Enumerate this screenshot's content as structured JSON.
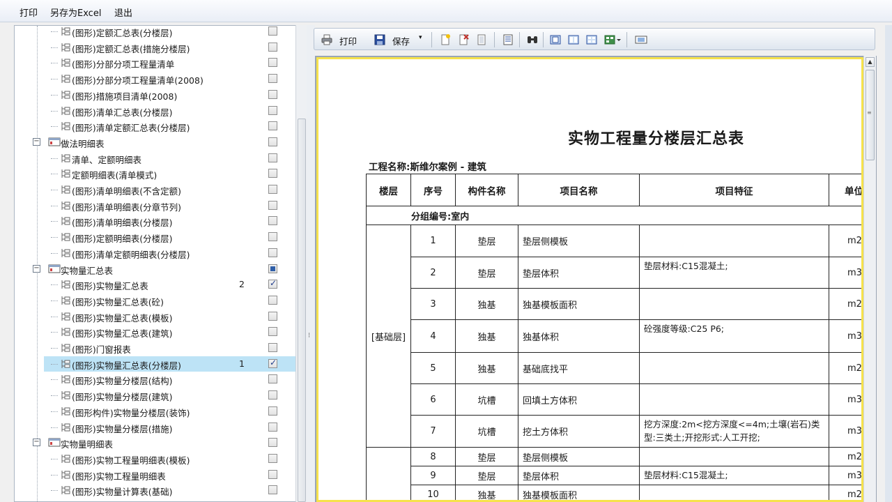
{
  "menu": {
    "print": "打印",
    "save_excel": "另存为Excel",
    "exit": "退出"
  },
  "tree": {
    "rows": [
      {
        "label": "(图形)定额汇总表(分楼层)",
        "checked": false,
        "count": ""
      },
      {
        "label": "(图形)定额汇总表(措施分楼层)",
        "checked": false,
        "count": ""
      },
      {
        "label": "(图形)分部分项工程量清单",
        "checked": false,
        "count": ""
      },
      {
        "label": "(图形)分部分项工程量清单(2008)",
        "checked": false,
        "count": ""
      },
      {
        "label": "(图形)措施项目清单(2008)",
        "checked": false,
        "count": ""
      },
      {
        "label": "(图形)清单汇总表(分楼层)",
        "checked": false,
        "count": ""
      },
      {
        "label": "(图形)清单定额汇总表(分楼层)",
        "checked": false,
        "count": ""
      },
      {
        "label": "做法明细表",
        "group": true,
        "checked": false,
        "count": ""
      },
      {
        "label": "清单、定额明细表",
        "checked": false,
        "count": ""
      },
      {
        "label": "定额明细表(清单模式)",
        "checked": false,
        "count": ""
      },
      {
        "label": "(图形)清单明细表(不含定额)",
        "checked": false,
        "count": ""
      },
      {
        "label": "(图形)清单明细表(分章节列)",
        "checked": false,
        "count": ""
      },
      {
        "label": "(图形)清单明细表(分楼层)",
        "checked": false,
        "count": ""
      },
      {
        "label": "(图形)定额明细表(分楼层)",
        "checked": false,
        "count": ""
      },
      {
        "label": "(图形)清单定额明细表(分楼层)",
        "checked": false,
        "count": ""
      },
      {
        "label": "实物量汇总表",
        "group": true,
        "partial": true,
        "count": ""
      },
      {
        "label": "(图形)实物量汇总表",
        "checked": true,
        "count": "2"
      },
      {
        "label": "(图形)实物量汇总表(砼)",
        "checked": false,
        "count": ""
      },
      {
        "label": "(图形)实物量汇总表(模板)",
        "checked": false,
        "count": ""
      },
      {
        "label": "(图形)实物量汇总表(建筑)",
        "checked": false,
        "count": ""
      },
      {
        "label": "(图形)门窗报表",
        "checked": false,
        "count": ""
      },
      {
        "label": "(图形)实物量汇总表(分楼层)",
        "checked": true,
        "count": "1",
        "selected": true
      },
      {
        "label": "(图形)实物量分楼层(结构)",
        "checked": false,
        "count": ""
      },
      {
        "label": "(图形)实物量分楼层(建筑)",
        "checked": false,
        "count": ""
      },
      {
        "label": "(图形构件)实物量分楼层(装饰)",
        "checked": false,
        "count": ""
      },
      {
        "label": "(图形)实物量分楼层(措施)",
        "checked": false,
        "count": ""
      },
      {
        "label": "实物量明细表",
        "group": true,
        "checked": false,
        "count": ""
      },
      {
        "label": "(图形)实物工程量明细表(模板)",
        "checked": false,
        "count": ""
      },
      {
        "label": "(图形)实物工程量明细表",
        "checked": false,
        "count": ""
      },
      {
        "label": "(图形)实物量计算表(基础)",
        "checked": false,
        "count": ""
      }
    ]
  },
  "toolbar": {
    "print": "打印",
    "save": "保存"
  },
  "report": {
    "title": "实物工程量分楼层汇总表",
    "project_name": "工程名称:斯维尔案例 - 建筑",
    "headers": [
      "楼层",
      "序号",
      "构件名称",
      "项目名称",
      "项目特征",
      "单位"
    ],
    "group_label": "分组编号:室内",
    "floor_label": "[基础层]",
    "rows": [
      {
        "no": "1",
        "component": "垫层",
        "item": "垫层侧模板",
        "feature": "",
        "unit": "m2"
      },
      {
        "no": "2",
        "component": "垫层",
        "item": "垫层体积",
        "feature": "垫层材料:C15混凝土;",
        "unit": "m3"
      },
      {
        "no": "3",
        "component": "独基",
        "item": "独基模板面积",
        "feature": "",
        "unit": "m2"
      },
      {
        "no": "4",
        "component": "独基",
        "item": "独基体积",
        "feature": "砼强度等级:C25 P6;",
        "unit": "m3"
      },
      {
        "no": "5",
        "component": "独基",
        "item": "基础底找平",
        "feature": "",
        "unit": "m2"
      },
      {
        "no": "6",
        "component": "坑槽",
        "item": "回填土方体积",
        "feature": "",
        "unit": "m3"
      },
      {
        "no": "7",
        "component": "坑槽",
        "item": "挖土方体积",
        "feature": "挖方深度:2m<挖方深度<=4m;土壤(岩石)类型:三类土;开挖形式:人工开挖;",
        "unit": "m3"
      },
      {
        "no": "8",
        "component": "垫层",
        "item": "垫层侧模板",
        "feature": "",
        "unit": "m2"
      },
      {
        "no": "9",
        "component": "垫层",
        "item": "垫层体积",
        "feature": "垫层材料:C15混凝土;",
        "unit": "m3"
      },
      {
        "no": "10",
        "component": "独基",
        "item": "独基模板面积",
        "feature": "",
        "unit": "m2"
      }
    ]
  }
}
